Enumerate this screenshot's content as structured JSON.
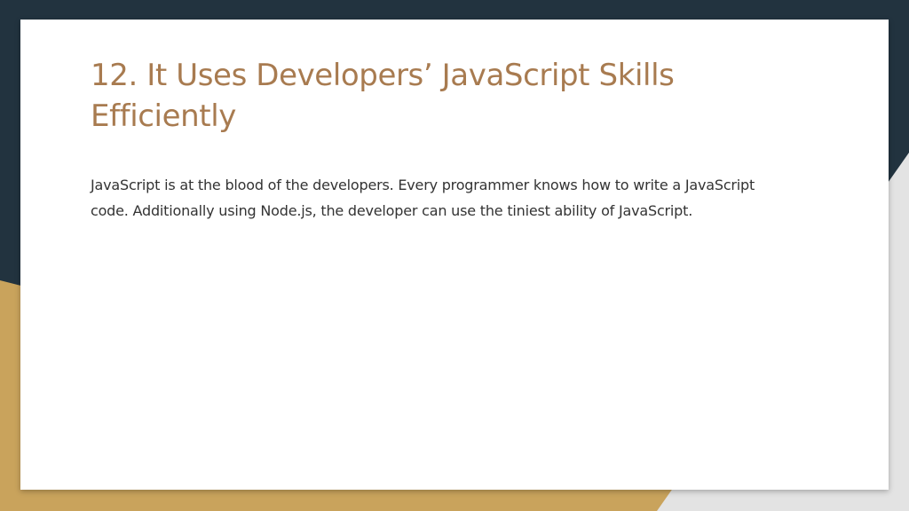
{
  "colors": {
    "navy": "#22333f",
    "gold": "#c9a35c",
    "gray": "#e3e3e3",
    "card": "#ffffff",
    "title": "#a87b50",
    "body": "#333333"
  },
  "slide": {
    "title": "12. It Uses Developers’ JavaScript Skills Efficiently",
    "body": "JavaScript is at the blood of the developers. Every programmer knows how to write a JavaScript code. Additionally using Node.js, the developer can use the tiniest ability of JavaScript."
  }
}
